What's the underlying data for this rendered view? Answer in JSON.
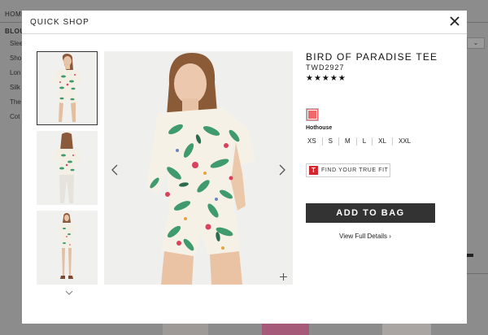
{
  "background": {
    "nav_label": "HOME",
    "category": "BLOU",
    "items": [
      "Slee",
      "Sho",
      "Lon",
      "Silk",
      "The",
      "Cot"
    ]
  },
  "modal": {
    "title": "QUICK SHOP",
    "close_icon": "close-icon"
  },
  "product": {
    "name": "BIRD OF PARADISE TEE",
    "sku": "TWD2927",
    "rating_stars": "★★★★★",
    "rating_value": 5,
    "color": {
      "name": "Hothouse",
      "hex": "#f0696a"
    },
    "sizes": [
      "XS",
      "S",
      "M",
      "L",
      "XL",
      "XXL"
    ],
    "fit_icon_letter": "T",
    "fit_label": "FIND YOUR TRUE FIT",
    "add_to_bag": "ADD TO BAG",
    "view_full_details": "View Full Details ›"
  },
  "gallery": {
    "thumbnails": [
      "thumbnail-front",
      "thumbnail-back",
      "thumbnail-full-length"
    ],
    "selected_index": 0,
    "icons": {
      "prev": "chevron-left-icon",
      "next": "chevron-right-icon",
      "zoom": "plus-icon",
      "more": "chevron-down-icon"
    }
  },
  "colors": {
    "accent": "#333333",
    "fit_brand": "#d2272e",
    "swatch": "#f0696a"
  }
}
